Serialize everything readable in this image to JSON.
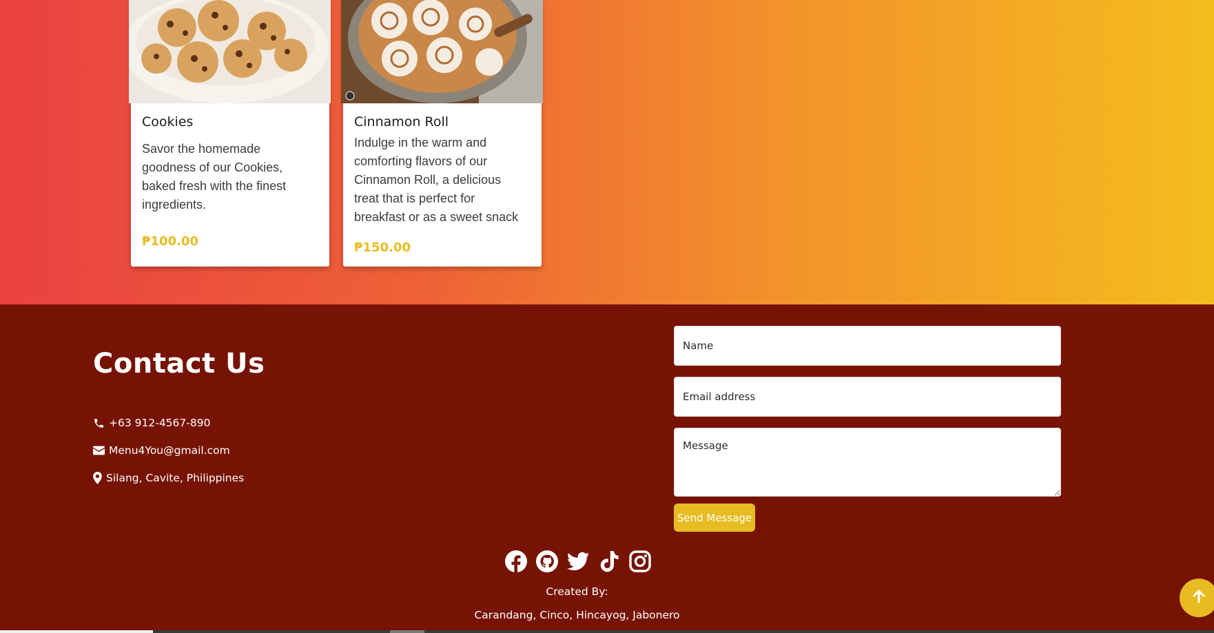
{
  "menu_items": [
    {
      "title": "Cookies",
      "description": "Savor the homemade goodness of our Cookies, baked fresh with the finest ingredients.",
      "price": "₱100.00"
    },
    {
      "title": "Cinnamon Roll",
      "description": "Indulge in the warm and comforting flavors of our Cinnamon Roll, a delicious treat that is perfect for breakfast or as a sweet snack",
      "price": "₱150.00"
    }
  ],
  "contact": {
    "heading": "Contact Us",
    "phone": "+63 912-4567-890",
    "email": "Menu4You@gmail.com",
    "address": "Silang, Cavite, Philippines",
    "phone_icon": "phone-icon",
    "email_icon": "envelope-icon",
    "address_icon": "map-marker-icon"
  },
  "form": {
    "name_placeholder": "Name",
    "email_placeholder": "Email address",
    "message_placeholder": "Message",
    "send_label": "Send Message"
  },
  "socials": [
    "facebook-icon",
    "github-icon",
    "twitter-icon",
    "tiktok-icon",
    "instagram-icon"
  ],
  "footer": {
    "created_by_label": "Created By:",
    "authors": "Carandang, Cinco, Hincayog, Jabonero"
  },
  "colors": {
    "gradient_start": "#ea4141",
    "gradient_end": "#f4bd1e",
    "footer_bg": "#771304",
    "accent": "#e6bc22"
  }
}
